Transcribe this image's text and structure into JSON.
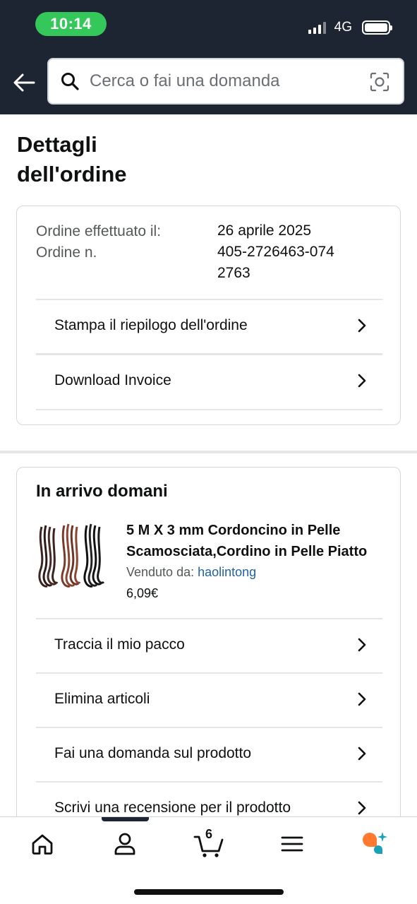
{
  "status_bar": {
    "time": "10:14",
    "network": "4G"
  },
  "search": {
    "placeholder": "Cerca o fai una domanda"
  },
  "page": {
    "title": "Dettagli dell'ordine"
  },
  "order_info": {
    "placed_label": "Ordine effettuato il:",
    "placed_value": "26 aprile 2025",
    "number_label": "Ordine n.",
    "number_value": "405-2726463-0742763"
  },
  "order_actions": [
    {
      "label": "Stampa il riepilogo dell'ordine"
    },
    {
      "label": "Download Invoice"
    }
  ],
  "shipment": {
    "title": "In arrivo domani",
    "product_title": "5 M X 3 mm Cordoncino in Pelle Scamosciata,Cordino in Pelle Piatto",
    "sold_by_label": "Venduto da:",
    "seller_name": "haolintong",
    "price": "6,09€",
    "actions": [
      {
        "label": "Traccia il mio pacco"
      },
      {
        "label": "Elimina articoli"
      },
      {
        "label": "Fai una domanda sul prodotto"
      },
      {
        "label": "Scrivi una recensione per il prodotto"
      }
    ]
  },
  "bottom_nav": {
    "cart_count": "6",
    "items": [
      "home-icon",
      "account-icon",
      "cart-icon",
      "menu-icon",
      "rufus-assistant-icon"
    ]
  },
  "colors": {
    "header_bg": "#1d2532",
    "time_pill": "#34c759",
    "link": "#2162a1",
    "assistant_orange": "#ff7a2f",
    "assistant_teal": "#1aa1b5"
  }
}
